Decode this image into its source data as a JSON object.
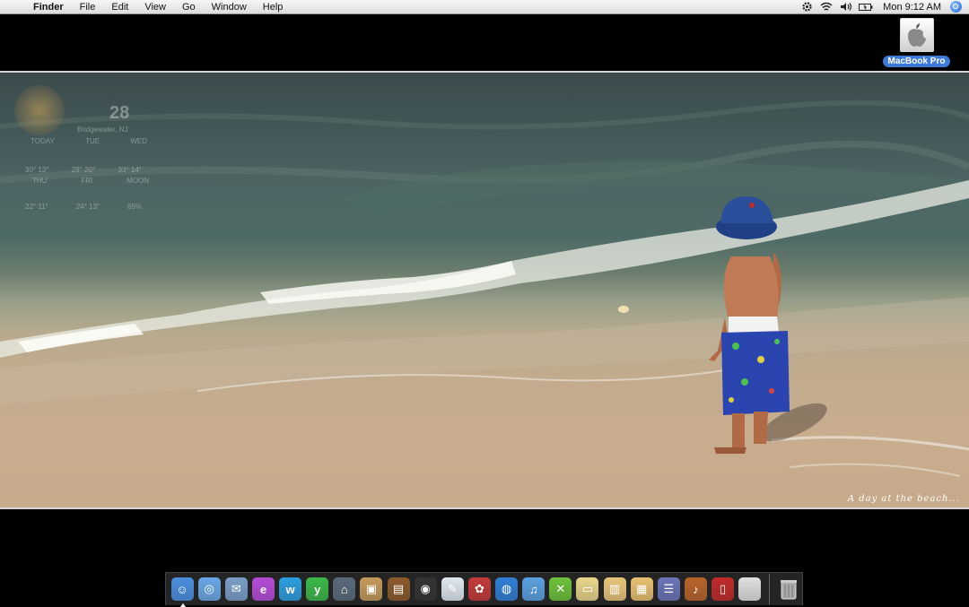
{
  "menubar": {
    "app_name": "Finder",
    "menus": [
      "File",
      "Edit",
      "View",
      "Go",
      "Window",
      "Help"
    ],
    "clock": "Mon 9:12 AM",
    "status_icons": [
      "gear-icon",
      "wifi-icon",
      "volume-icon",
      "battery-icon"
    ]
  },
  "desktop": {
    "drive_label": "MacBook Pro",
    "wallpaper_caption": "A day at the beach..."
  },
  "weather_widget": {
    "current_temp": "28",
    "location": "Bridgewater, NJ",
    "days": [
      "TODAY",
      "TUE",
      "WED",
      "THU",
      "FRI",
      "MOON"
    ],
    "row1": [
      [
        "30°",
        "13°"
      ],
      [
        "28°",
        "20°"
      ],
      [
        "33°",
        "14°"
      ]
    ],
    "row2": [
      [
        "22°",
        "11°"
      ],
      [
        "24°",
        "13°"
      ],
      [
        "65%",
        ""
      ]
    ]
  },
  "dock": {
    "apps": [
      {
        "name": "finder-icon",
        "color": "#4a8fe0",
        "glyph": "☺"
      },
      {
        "name": "safari-icon",
        "color": "#6aa8e8",
        "glyph": "◎"
      },
      {
        "name": "mail-icon",
        "color": "#7a9ec8",
        "glyph": "✉"
      },
      {
        "name": "app-e-icon",
        "color": "#b54bd8",
        "glyph": "e"
      },
      {
        "name": "app-w-icon",
        "color": "#2c9ee0",
        "glyph": "w"
      },
      {
        "name": "app-y-icon",
        "color": "#3bb84a",
        "glyph": "y"
      },
      {
        "name": "network-icon",
        "color": "#5a6a7a",
        "glyph": "⌂"
      },
      {
        "name": "iphoto-icon",
        "color": "#c49a5a",
        "glyph": "▣"
      },
      {
        "name": "photobooth-icon",
        "color": "#8b5a2b",
        "glyph": "▤"
      },
      {
        "name": "camera-icon",
        "color": "#333333",
        "glyph": "◉"
      },
      {
        "name": "quill-icon",
        "color": "#dfe8f0",
        "glyph": "✎"
      },
      {
        "name": "flower-icon",
        "color": "#c33a3a",
        "glyph": "✿"
      },
      {
        "name": "dvd-icon",
        "color": "#2f7fd6",
        "glyph": "◍"
      },
      {
        "name": "itunes-icon",
        "color": "#5aa0e0",
        "glyph": "♫"
      },
      {
        "name": "xbox-icon",
        "color": "#6cc23a",
        "glyph": "✕"
      },
      {
        "name": "toaster-icon",
        "color": "#e8d68a",
        "glyph": "▭"
      },
      {
        "name": "popcorn-icon",
        "color": "#e8c57a",
        "glyph": "▥"
      },
      {
        "name": "notepad-icon",
        "color": "#e8c070",
        "glyph": "▦"
      },
      {
        "name": "spreadsheet-icon",
        "color": "#6a74b8",
        "glyph": "☰"
      },
      {
        "name": "guitar-icon",
        "color": "#b8642a",
        "glyph": "♪"
      },
      {
        "name": "book-icon",
        "color": "#c02a2a",
        "glyph": "▯"
      },
      {
        "name": "apple-icon",
        "color": "#e0e0e0",
        "glyph": ""
      }
    ],
    "trash": {
      "name": "trash-icon",
      "color": "#9a9a9a",
      "glyph": "🗑"
    }
  }
}
